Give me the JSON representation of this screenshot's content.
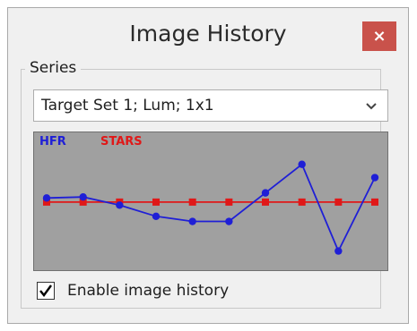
{
  "window": {
    "title": "Image History",
    "close_label": "×"
  },
  "series_group": {
    "label": "Series",
    "selected": "Target Set 1; Lum; 1x1"
  },
  "chart": {
    "background": "#a0a0a0",
    "legend": {
      "hfr": "HFR",
      "stars": "STARS"
    },
    "colors": {
      "hfr": "#1f1fd6",
      "stars": "#e01818"
    }
  },
  "chart_data": {
    "type": "line",
    "x": [
      1,
      2,
      3,
      4,
      5,
      6,
      7,
      8,
      9,
      10
    ],
    "series": [
      {
        "name": "HFR",
        "values": [
          0.62,
          0.63,
          0.55,
          0.44,
          0.39,
          0.39,
          0.67,
          0.95,
          0.1,
          0.82
        ]
      },
      {
        "name": "STARS",
        "values": [
          0.58,
          0.58,
          0.58,
          0.58,
          0.58,
          0.58,
          0.58,
          0.58,
          0.58,
          0.58
        ]
      }
    ],
    "ylim": [
      0,
      1
    ],
    "grid": false,
    "legend": "top-left"
  },
  "options": {
    "enable_history_label": "Enable image history",
    "enable_history_checked": true
  }
}
